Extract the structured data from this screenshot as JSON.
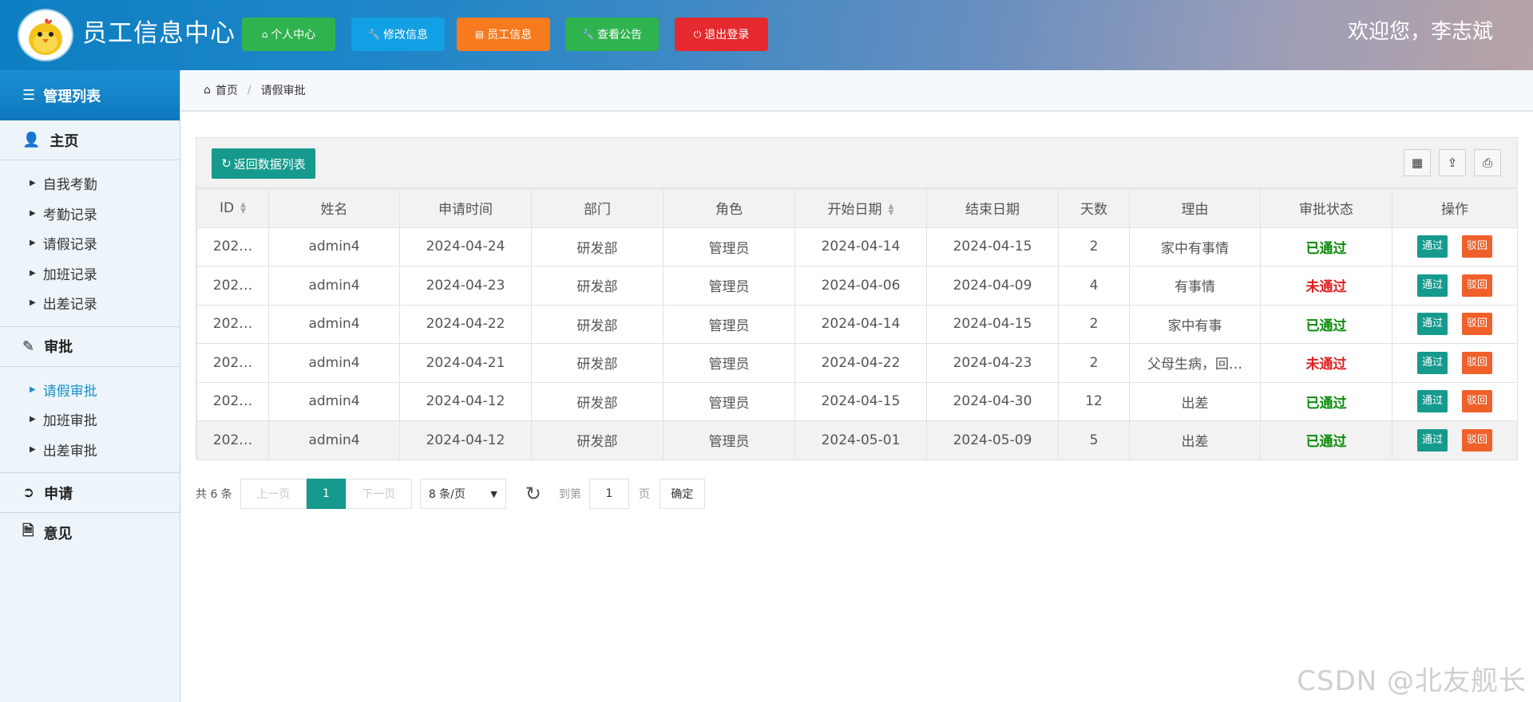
{
  "header": {
    "title": "员工信息中心",
    "nav": [
      {
        "label": "个人中心",
        "icon": "home-icon",
        "color": "#2fb34e"
      },
      {
        "label": "修改信息",
        "icon": "wrench-icon",
        "color": "#12a0e4"
      },
      {
        "label": "员工信息",
        "icon": "document-icon",
        "color": "#f77a1e"
      },
      {
        "label": "查看公告",
        "icon": "wrench-icon",
        "color": "#2fb34e"
      },
      {
        "label": "退出登录",
        "icon": "power-icon",
        "color": "#e5292f"
      }
    ],
    "welcome": "欢迎您，李志斌"
  },
  "sidebar": {
    "title": "管理列表",
    "groups": [
      {
        "label": "主页",
        "items": [
          "自我考勤",
          "考勤记录",
          "请假记录",
          "加班记录",
          "出差记录"
        ]
      },
      {
        "label": "审批",
        "items": [
          "请假审批",
          "加班审批",
          "出差审批"
        ],
        "active": "请假审批"
      },
      {
        "label": "申请"
      },
      {
        "label": "意见"
      }
    ]
  },
  "breadcrumb": {
    "home": "首页",
    "current": "请假审批"
  },
  "toolbar": {
    "back_label": "返回数据列表"
  },
  "table": {
    "columns": [
      "ID",
      "姓名",
      "申请时间",
      "部门",
      "角色",
      "开始日期",
      "结束日期",
      "天数",
      "理由",
      "审批状态",
      "操作"
    ],
    "rows": [
      {
        "id": "202…",
        "name": "admin4",
        "apply": "2024-04-24",
        "dept": "研发部",
        "role": "管理员",
        "start": "2024-04-14",
        "end": "2024-04-15",
        "days": "2",
        "reason": "家中有事情",
        "status": "已通过"
      },
      {
        "id": "202…",
        "name": "admin4",
        "apply": "2024-04-23",
        "dept": "研发部",
        "role": "管理员",
        "start": "2024-04-06",
        "end": "2024-04-09",
        "days": "4",
        "reason": "有事情",
        "status": "未通过"
      },
      {
        "id": "202…",
        "name": "admin4",
        "apply": "2024-04-22",
        "dept": "研发部",
        "role": "管理员",
        "start": "2024-04-14",
        "end": "2024-04-15",
        "days": "2",
        "reason": "家中有事",
        "status": "已通过"
      },
      {
        "id": "202…",
        "name": "admin4",
        "apply": "2024-04-21",
        "dept": "研发部",
        "role": "管理员",
        "start": "2024-04-22",
        "end": "2024-04-23",
        "days": "2",
        "reason": "父母生病，回…",
        "status": "未通过"
      },
      {
        "id": "202…",
        "name": "admin4",
        "apply": "2024-04-12",
        "dept": "研发部",
        "role": "管理员",
        "start": "2024-04-15",
        "end": "2024-04-30",
        "days": "12",
        "reason": "出差",
        "status": "已通过"
      },
      {
        "id": "202…",
        "name": "admin4",
        "apply": "2024-04-12",
        "dept": "研发部",
        "role": "管理员",
        "start": "2024-05-01",
        "end": "2024-05-09",
        "days": "5",
        "reason": "出差",
        "status": "已通过"
      }
    ],
    "pass_label": "通过",
    "reject_label": "驳回"
  },
  "pager": {
    "total": "共 6 条",
    "prev": "上一页",
    "current": "1",
    "next": "下一页",
    "page_size": "8 条/页",
    "goto_label": "到第",
    "goto_value": "1",
    "page_unit": "页",
    "confirm": "确定"
  },
  "watermark": "CSDN @北友舰长"
}
